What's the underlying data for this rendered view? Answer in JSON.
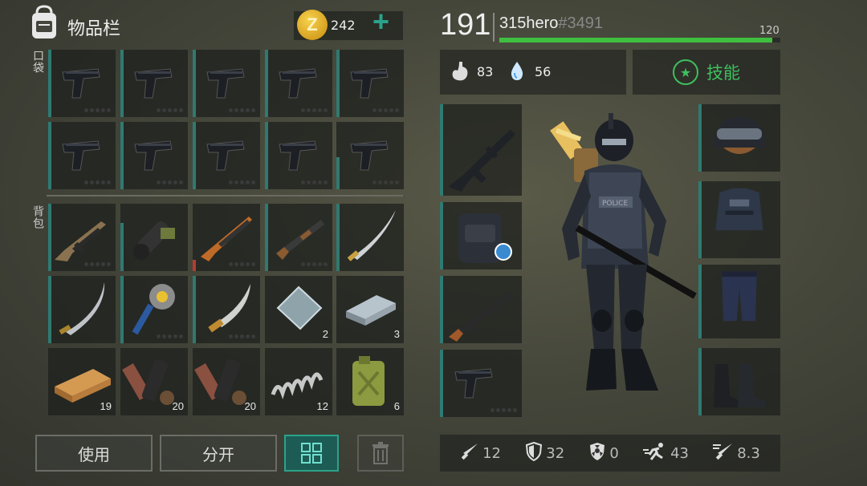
{
  "inventory": {
    "title": "物品栏",
    "coins": "242",
    "coin_symbol": "Z",
    "add_symbol": "+",
    "pocket_label": "口袋",
    "backpack_label": "背包",
    "pocket_items": [
      {
        "name": "pistol",
        "count": ""
      },
      {
        "name": "pistol",
        "count": ""
      },
      {
        "name": "pistol",
        "count": ""
      },
      {
        "name": "pistol",
        "count": ""
      },
      {
        "name": "pistol",
        "count": ""
      },
      {
        "name": "pistol",
        "count": ""
      },
      {
        "name": "pistol",
        "count": ""
      },
      {
        "name": "pistol",
        "count": ""
      },
      {
        "name": "pistol",
        "count": ""
      },
      {
        "name": "pistol",
        "count": ""
      }
    ],
    "backpack_items": [
      {
        "name": "assault-rifle",
        "count": ""
      },
      {
        "name": "heavy-gun",
        "count": ""
      },
      {
        "name": "hunting-rifle",
        "count": ""
      },
      {
        "name": "shotgun",
        "count": ""
      },
      {
        "name": "katana",
        "count": ""
      },
      {
        "name": "curved-sword",
        "count": ""
      },
      {
        "name": "spiked-club",
        "count": ""
      },
      {
        "name": "machete",
        "count": ""
      },
      {
        "name": "metal-plate",
        "count": "2"
      },
      {
        "name": "iron-ingot",
        "count": "3"
      },
      {
        "name": "wood-plank",
        "count": "19"
      },
      {
        "name": "gun-parts",
        "count": "20"
      },
      {
        "name": "gun-parts",
        "count": "20"
      },
      {
        "name": "spring",
        "count": "12"
      },
      {
        "name": "jerry-can",
        "count": "6"
      }
    ]
  },
  "buttons": {
    "use": "使用",
    "split": "分开"
  },
  "player": {
    "level": "191",
    "name": "315hero",
    "tag": "#3491",
    "xp_max": "120",
    "xp_fraction": 0.97,
    "food": "83",
    "water": "56",
    "skills_label": "技能"
  },
  "equipment": {
    "left": [
      "m16-rifle",
      "backpack",
      "ak47",
      "pistol"
    ],
    "right": [
      "helmet",
      "body-armor",
      "pants",
      "boots"
    ]
  },
  "stats": {
    "attack": "12",
    "defense": "32",
    "radiation": "0",
    "speed": "43",
    "attack_speed": "8.3"
  },
  "colors": {
    "accent": "#2aa38a",
    "xp_bar": "#3fbf3f",
    "slot_bar": "#2f7a72",
    "coin": "#e0a81e"
  }
}
